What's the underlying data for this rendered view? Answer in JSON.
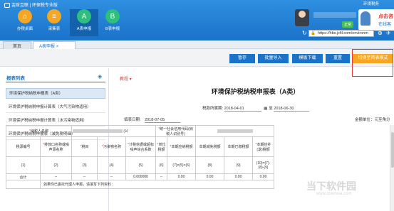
{
  "header": {
    "logo_text": "金财互联 | 环保税专业版",
    "top_link": "环境税务",
    "nav": [
      {
        "label": "办税桌面",
        "icon": "home-icon",
        "color": "#f5a623"
      },
      {
        "label": "采集表",
        "icon": "collect-icon",
        "color": "#f5a623"
      },
      {
        "label": "A表申报",
        "icon": "a-declare-icon",
        "color": "#2dbf7b"
      },
      {
        "label": "B表申报",
        "icon": "b-declare-icon",
        "color": "#2dbf7b"
      }
    ],
    "badge": "正常",
    "customer_service": {
      "line1": "点击咨",
      "line2": "在线客"
    },
    "url": "https://hbs.jcfil.com/environm"
  },
  "tabs": [
    {
      "label": "首页",
      "active": false
    },
    {
      "label": "A表申报",
      "active": true,
      "close": "×"
    }
  ],
  "toolbar": {
    "buttons": [
      "暂存",
      "批量导入",
      "模板下载",
      "重置",
      "切换至简表模式"
    ],
    "highlight_color": "#e53935"
  },
  "sidebar": {
    "title": "报表列表",
    "items": [
      "环境保护税纳税申报表（A类）",
      "环境保护税纳税申报计算表（大气污染物适用）",
      "环境保护税纳税申报计算表（水污染物适用）",
      "环境保护税纳税申报表（减免税明细）"
    ]
  },
  "form": {
    "tutorial": "教程",
    "title": "环境保护税纳税申报表（A类）",
    "period_label": "税款所属期:",
    "period_from": "2018-04-01",
    "period_to": "2018-06-30",
    "period_sep": "至",
    "fill_date_label": "填表日期:",
    "fill_date": "2018-07-05",
    "amount_unit": "金额单位：元至角分",
    "taxpayer_name_label": "纳税人名称",
    "taxpayer_name_suffix": "(公",
    "credit_code_label": "统一社会信用代码(纳税人识别号)",
    "columns": [
      {
        "name": "税源编号",
        "num": "(1)"
      },
      {
        "name": "排放口名称或噪声源名称",
        "num": "(2)",
        "required": true
      },
      {
        "name": "税目",
        "num": "(3)",
        "required": true
      },
      {
        "name": "污染物名称",
        "num": "(4)",
        "required": true
      },
      {
        "name": "计税依据或超标噪声综合系数",
        "num": "(5)",
        "required": true
      },
      {
        "name": "单位税额",
        "num": "(6)",
        "required": true
      },
      {
        "name": "本期应纳税额",
        "num": "(7)=(5)×(6)",
        "required": true
      },
      {
        "name": "本期减免税额",
        "num": "(8)"
      },
      {
        "name": "本期已缴税额",
        "num": "(9)"
      },
      {
        "name": "本期应补(退)税额",
        "num": "(10)=(7)-(8)-(9)",
        "required": true
      }
    ],
    "total_label": "合计",
    "total_values": [
      "--",
      "--",
      "--",
      "0.000000",
      "--",
      "0.00",
      "0.00",
      "0.00",
      "0.00"
    ],
    "footer_note": "如果你已委托代理人申报，请填写下列资料："
  },
  "watermark": {
    "line1": "当下软件园",
    "line2": "www.downxia.com"
  }
}
